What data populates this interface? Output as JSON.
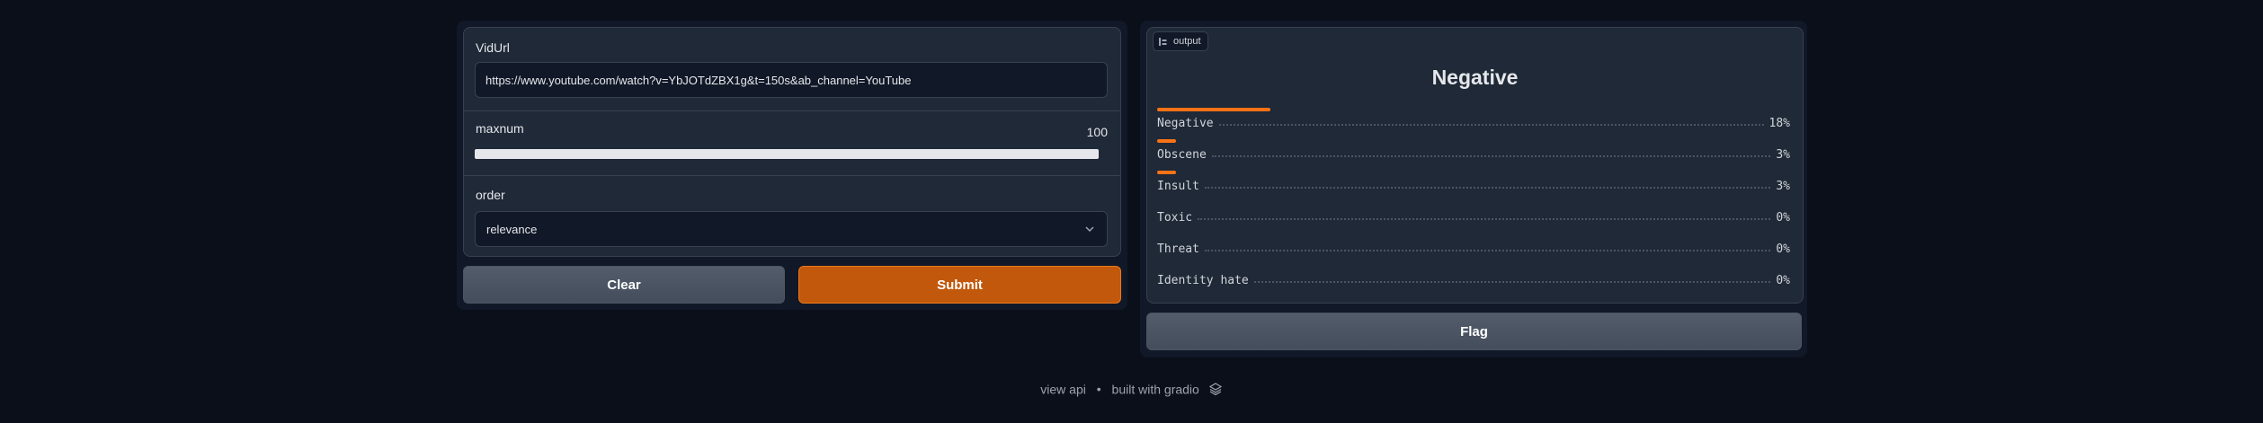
{
  "inputs": {
    "vidurl": {
      "label": "VidUrl",
      "value": "https://www.youtube.com/watch?v=YbJOTdZBX1g&t=150s&ab_channel=YouTube"
    },
    "maxnum": {
      "label": "maxnum",
      "value": "100",
      "fill_fraction": 1.0
    },
    "order": {
      "label": "order",
      "selected": "relevance"
    }
  },
  "buttons": {
    "clear": "Clear",
    "submit": "Submit",
    "flag": "Flag"
  },
  "output": {
    "tag": "output",
    "label": "Negative",
    "confidences": [
      {
        "name": "Negative",
        "pct": "18%",
        "fraction": 0.18
      },
      {
        "name": "Obscene",
        "pct": "3%",
        "fraction": 0.03
      },
      {
        "name": "Insult",
        "pct": "3%",
        "fraction": 0.03
      },
      {
        "name": "Toxic",
        "pct": "0%",
        "fraction": 0.0
      },
      {
        "name": "Threat",
        "pct": "0%",
        "fraction": 0.0
      },
      {
        "name": "Identity hate",
        "pct": "0%",
        "fraction": 0.0
      }
    ]
  },
  "footer": {
    "api": "view api",
    "sep": "•",
    "built": "built with gradio"
  },
  "colors": {
    "accent": "#ea7a1a",
    "bar": "#f97316",
    "background": "#0b0f19"
  }
}
